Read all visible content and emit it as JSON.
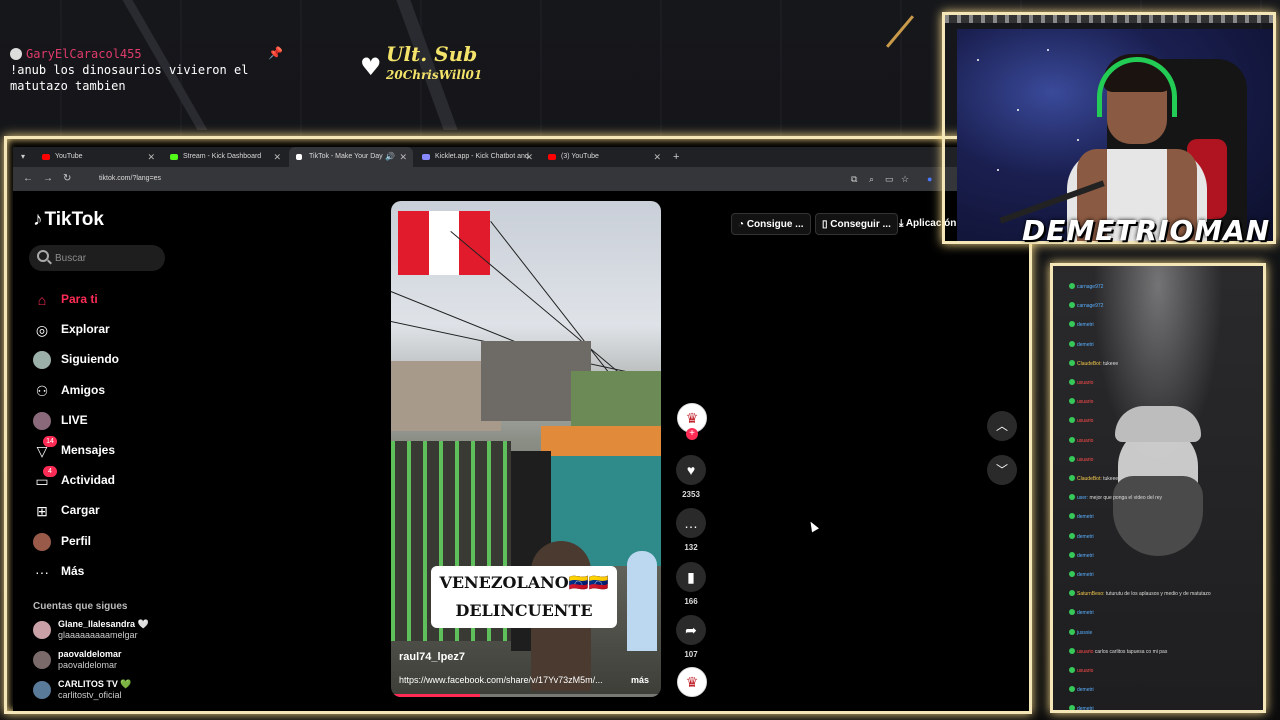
{
  "overlay": {
    "chat_user": "GaryElCaracol455",
    "chat_message": "!anub los dinosaurios vivieron el matutazo tambien",
    "last_sub_title": "Ult. Sub",
    "last_sub_name": "20ChrisWill01",
    "streamer_name": "DEMETRIOMAN"
  },
  "browser": {
    "tabs": [
      {
        "label": "YouTube",
        "color": "#ff0000"
      },
      {
        "label": "Stream - Kick Dashboard",
        "color": "#53fc18"
      },
      {
        "label": "TikTok - Make Your Day",
        "color": "#ffffff"
      },
      {
        "label": "Kicklet.app - Kick Chatbot and",
        "color": "#8888ff"
      },
      {
        "label": "(3) YouTube",
        "color": "#ff0000"
      }
    ],
    "url": "tiktok.com/?lang=es"
  },
  "tiktok": {
    "logo": "TikTok",
    "search_placeholder": "Buscar",
    "nav": [
      {
        "label": "Para ti",
        "icon": "home-icon",
        "active": true
      },
      {
        "label": "Explorar",
        "icon": "compass-icon"
      },
      {
        "label": "Siguiendo",
        "icon": "avatar-icon"
      },
      {
        "label": "Amigos",
        "icon": "friends-icon"
      },
      {
        "label": "LIVE",
        "icon": "live-icon"
      },
      {
        "label": "Mensajes",
        "icon": "message-icon",
        "badge": "14"
      },
      {
        "label": "Actividad",
        "icon": "activity-icon",
        "badge": "4"
      },
      {
        "label": "Cargar",
        "icon": "upload-icon"
      },
      {
        "label": "Perfil",
        "icon": "profile-icon"
      },
      {
        "label": "Más",
        "icon": "more-icon"
      }
    ],
    "following_title": "Cuentas que sigues",
    "following": [
      {
        "name": "Glane_llalesandra 🤍",
        "handle": "glaaaaaaaaamelgar"
      },
      {
        "name": "paovaldelomar",
        "handle": "paovaldelomar"
      },
      {
        "name": "CARLITOS TV 💚",
        "handle": "carlitostv_oficial"
      }
    ],
    "top_buttons": [
      "Consigue ...",
      "Conseguir ...",
      "Aplicación"
    ],
    "video": {
      "caption_line1": "VENEZOLANO🇻🇪🇻🇪",
      "caption_line2": "DELINCUENTE",
      "username": "raul74_lpez7",
      "link": "https://www.facebook.com/share/v/17Yv73zM5m/...",
      "more": "más",
      "progress": 0.33
    },
    "actions": {
      "likes": "2353",
      "comments": "132",
      "saves": "166",
      "shares": "107"
    }
  },
  "chat_panel": {
    "lines": [
      {
        "user": "carnage972",
        "color": "blue",
        "text": ""
      },
      {
        "user": "carnage972",
        "color": "blue",
        "text": ""
      },
      {
        "user": "demetri",
        "color": "blue",
        "text": ""
      },
      {
        "user": "demetri",
        "color": "blue",
        "text": ""
      },
      {
        "user": "ClaudeBot:",
        "color": "yel",
        "text": "tukeee"
      },
      {
        "user": "usuario",
        "color": "red",
        "text": ""
      },
      {
        "user": "usuario",
        "color": "red",
        "text": ""
      },
      {
        "user": "usuario",
        "color": "red",
        "text": ""
      },
      {
        "user": "usuario",
        "color": "red",
        "text": ""
      },
      {
        "user": "usuario",
        "color": "red",
        "text": ""
      },
      {
        "user": "ClaudeBot:",
        "color": "yel",
        "text": "tukeee"
      },
      {
        "user": "user:",
        "color": "blue",
        "text": "mejor que ponga el video del rey"
      },
      {
        "user": "demetri",
        "color": "blue",
        "text": ""
      },
      {
        "user": "demetri",
        "color": "blue",
        "text": ""
      },
      {
        "user": "demetri",
        "color": "blue",
        "text": ""
      },
      {
        "user": "demetri",
        "color": "blue",
        "text": ""
      },
      {
        "user": "SaturnBeso:",
        "color": "yel",
        "text": "tuturutu de los aplausos y medio y de matutazo"
      },
      {
        "user": "demetri",
        "color": "blue",
        "text": ""
      },
      {
        "user": "jussxie",
        "color": "blue",
        "text": ""
      },
      {
        "user": "usuario",
        "color": "red",
        "text": "carlos carlitos tapuesa co mi pas"
      },
      {
        "user": "usuario",
        "color": "red",
        "text": ""
      },
      {
        "user": "demetri",
        "color": "blue",
        "text": ""
      },
      {
        "user": "demetri",
        "color": "blue",
        "text": ""
      }
    ]
  }
}
